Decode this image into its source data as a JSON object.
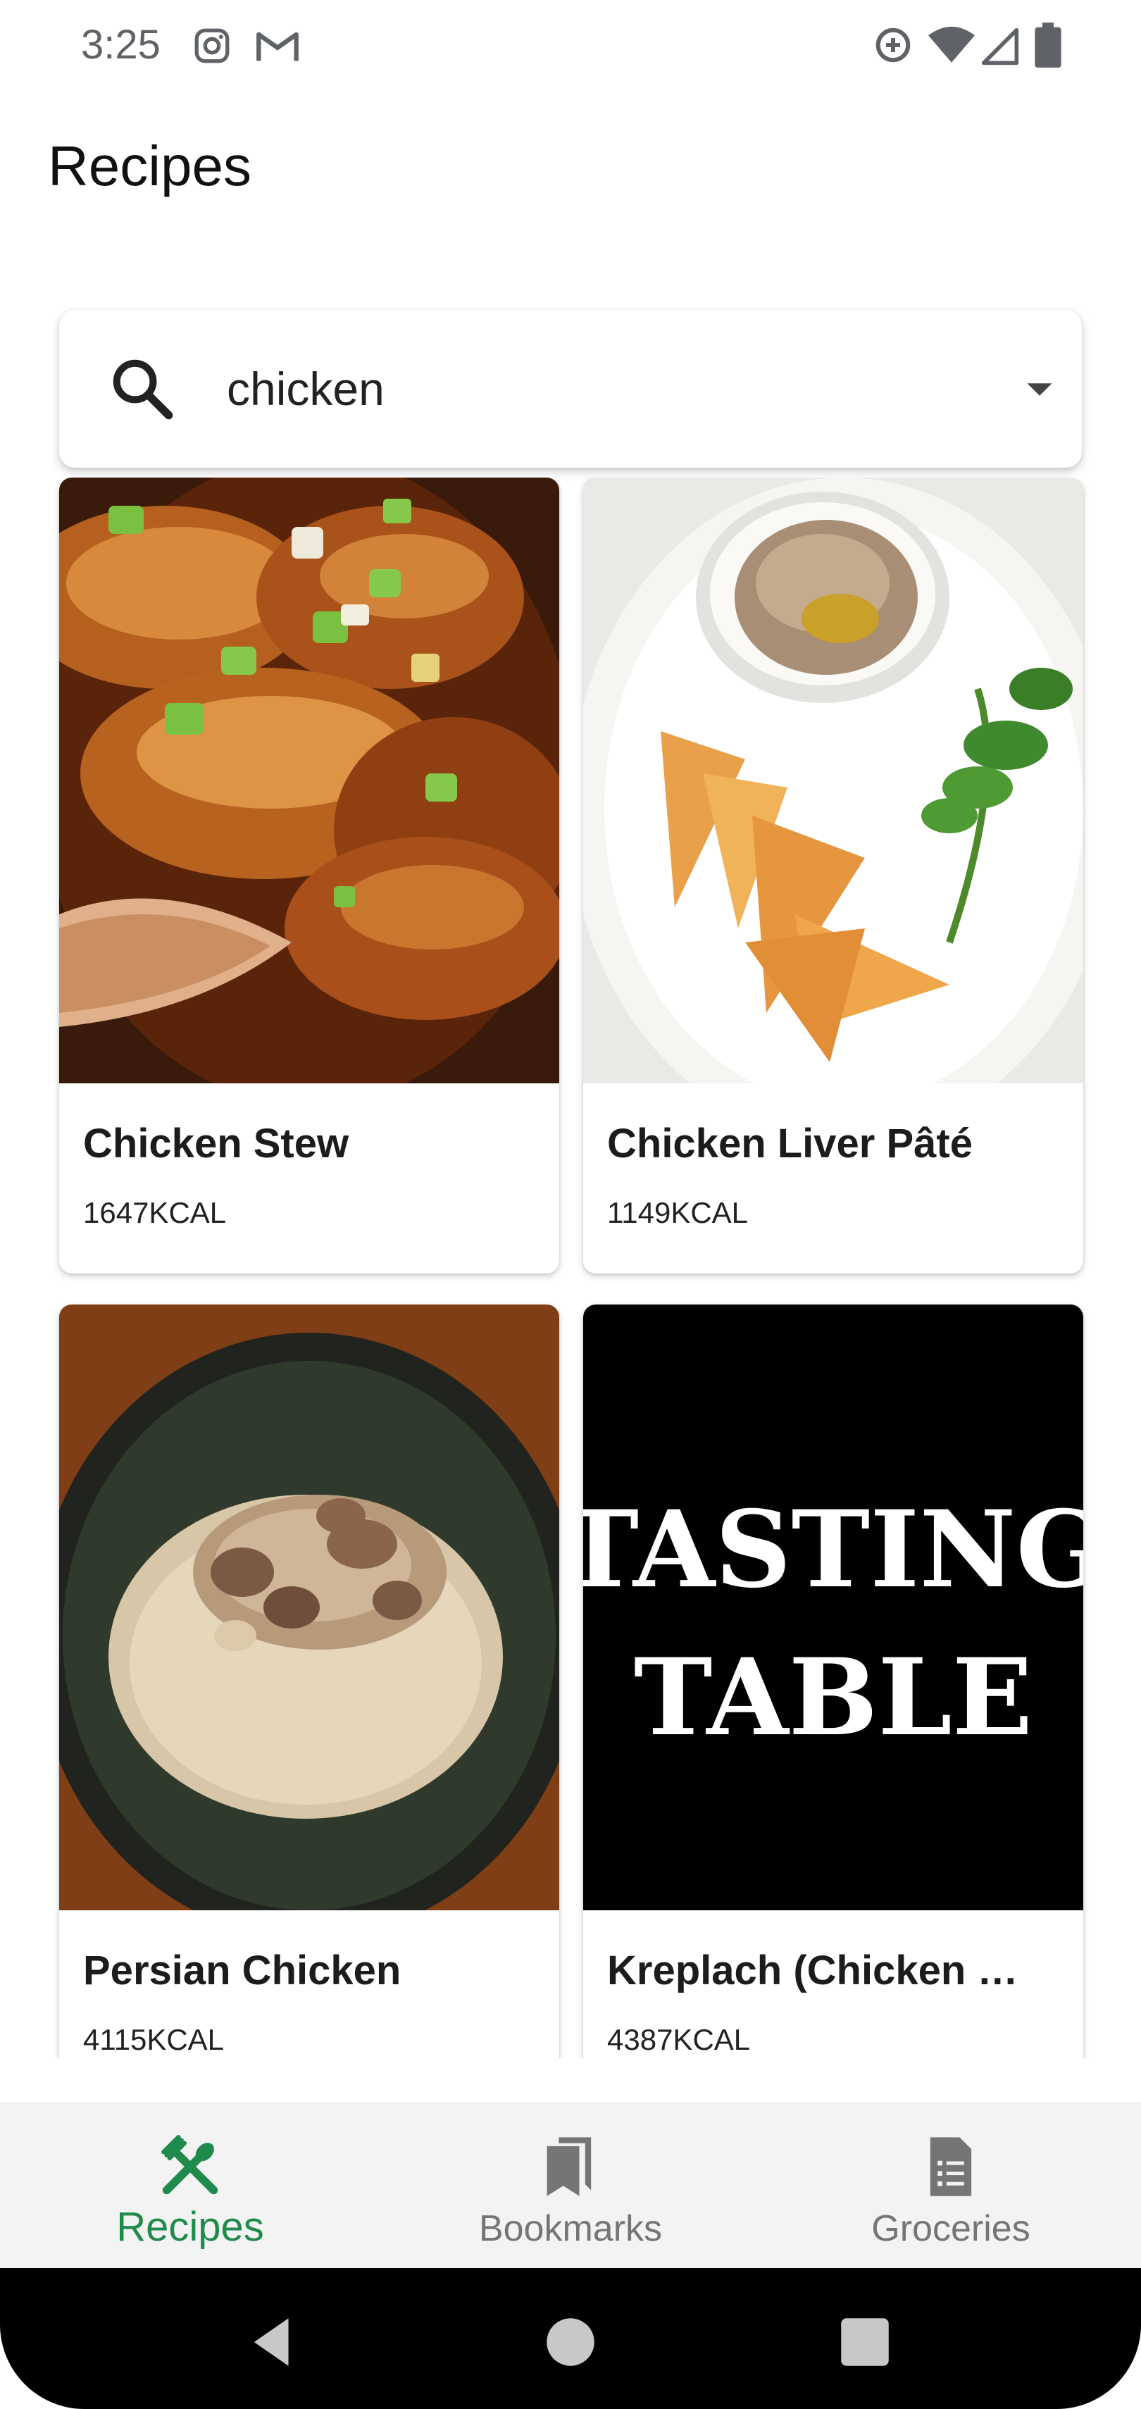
{
  "status_bar": {
    "time": "3:25",
    "left_icons": [
      "instagram-icon",
      "gmail-icon"
    ],
    "right_icons": [
      "data-saver-icon",
      "wifi-icon",
      "cell-signal-icon",
      "battery-icon"
    ]
  },
  "header": {
    "title": "Recipes"
  },
  "search": {
    "value": "chicken",
    "icon": "search-icon",
    "dropdown_icon": "dropdown-arrow-icon"
  },
  "recipes": [
    {
      "title": "Chicken Stew",
      "kcal": "1647KCAL"
    },
    {
      "title": "Chicken Liver Pâté",
      "kcal": "1149KCAL"
    },
    {
      "title": "Persian Chicken",
      "kcal": "4115KCAL"
    },
    {
      "title": "Kreplach (Chicken …",
      "kcal": "4387KCAL",
      "image_logo_text": [
        "TASTING",
        "TABLE"
      ]
    }
  ],
  "bottom_nav": {
    "items": [
      {
        "label": "Recipes",
        "icon": "restaurant-icon",
        "active": true
      },
      {
        "label": "Bookmarks",
        "icon": "bookmarks-icon",
        "active": false
      },
      {
        "label": "Groceries",
        "icon": "groceries-icon",
        "active": false
      }
    ]
  },
  "colors": {
    "accent": "#1f8a4c",
    "inactive": "#757575",
    "nav_background": "#f4f3f3"
  }
}
